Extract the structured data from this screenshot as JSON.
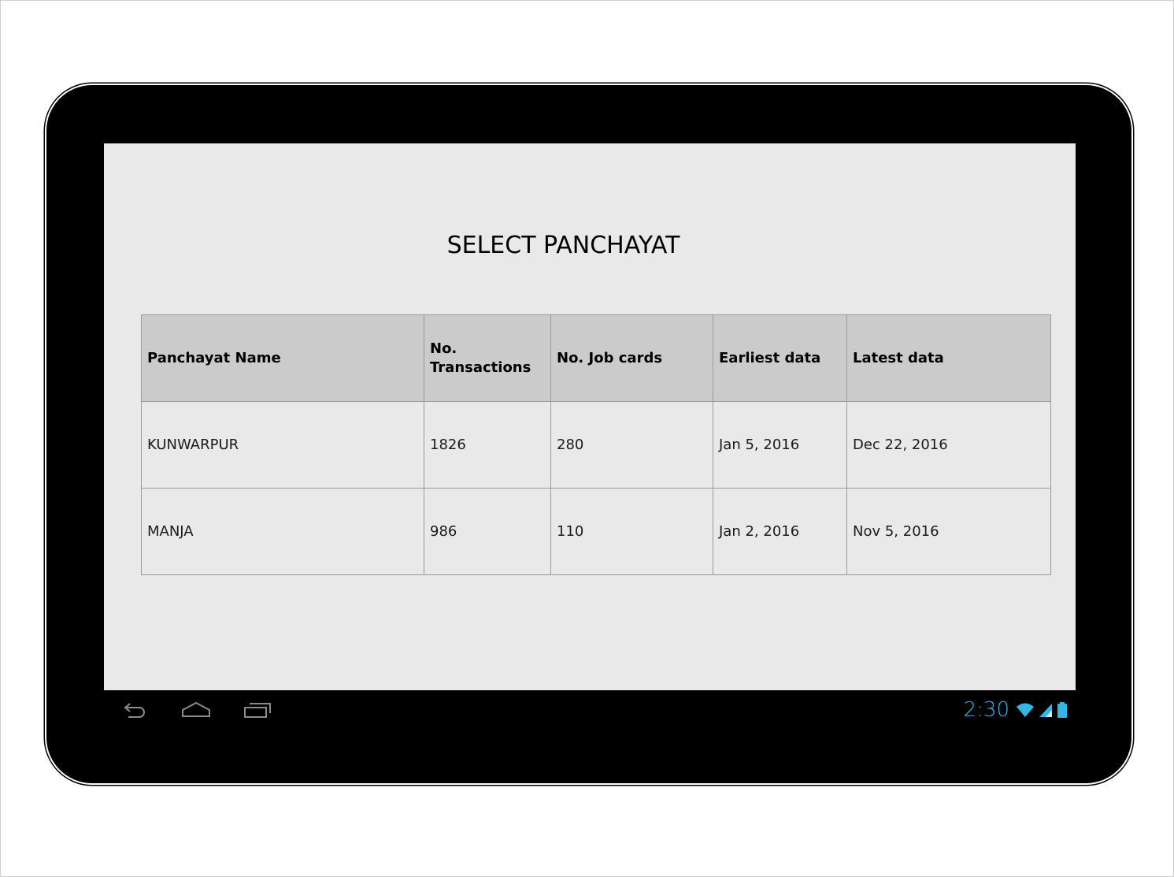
{
  "screen": {
    "title": "SELECT PANCHAYAT"
  },
  "table": {
    "headers": [
      "Panchayat Name",
      "No. Transactions",
      "No. Job cards",
      "Earliest data",
      "Latest data"
    ],
    "rows": [
      [
        "KUNWARPUR",
        "1826",
        "280",
        "Jan 5, 2016",
        "Dec 22, 2016"
      ],
      [
        "MANJA",
        "986",
        "110",
        "Jan 2, 2016",
        "Nov 5, 2016"
      ]
    ]
  },
  "status_bar": {
    "time": "2:30",
    "accent_color": "#33b5e5",
    "icons": [
      "wifi-icon",
      "signal-icon",
      "battery-icon"
    ]
  },
  "nav_bar": {
    "icons": [
      "back-icon",
      "home-icon",
      "recent-apps-icon"
    ]
  }
}
